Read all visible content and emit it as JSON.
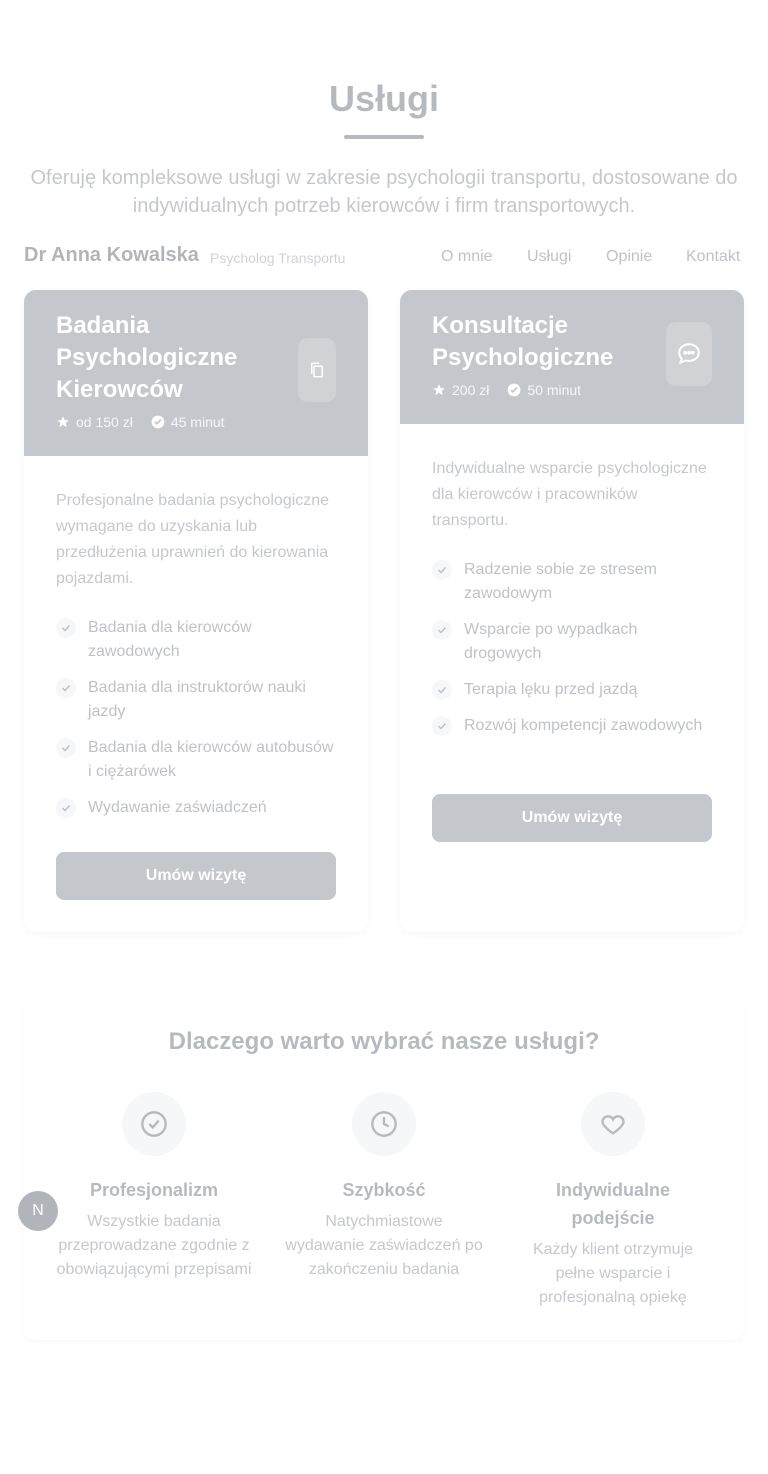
{
  "section": {
    "title": "Usługi",
    "lead": "Oferuję kompleksowe usługi w zakresie psychologii transportu, dostosowane do indywidualnych potrzeb kierowców i firm transportowych."
  },
  "header": {
    "brand": "Dr Anna Kowalska",
    "tagline": "Psycholog Transportu",
    "nav": [
      "O mnie",
      "Usługi",
      "Opinie",
      "Kontakt"
    ]
  },
  "services": [
    {
      "title": "Badania Psychologiczne Kierowców",
      "icon": "document-copy-icon",
      "price": "od 150 zł",
      "duration": "45 minut",
      "description": "Profesjonalne badania psychologiczne wymagane do uzyskania lub przedłużenia uprawnień do kierowania pojazdami.",
      "features": [
        "Badania dla kierowców zawodowych",
        "Badania dla instruktorów nauki jazdy",
        "Badania dla kierowców autobusów i ciężarówek",
        "Wydawanie zaświadczeń"
      ],
      "cta": "Umów wizytę"
    },
    {
      "title": "Konsultacje Psychologiczne",
      "icon": "chat-bubble-icon",
      "price": "200 zł",
      "duration": "50 minut",
      "description": "Indywidualne wsparcie psychologiczne dla kierowców i pracowników transportu.",
      "features": [
        "Radzenie sobie ze stresem zawodowym",
        "Wsparcie po wypadkach drogowych",
        "Terapia lęku przed jazdą",
        "Rozwój kompetencji zawodowych"
      ],
      "cta": "Umów wizytę"
    }
  ],
  "why": {
    "title": "Dlaczego warto wybrać nasze usługi?",
    "items": [
      {
        "icon": "check-circle-icon",
        "title": "Profesjonalizm",
        "text": "Wszystkie badania przeprowadzane zgodnie z obowiązującymi przepisami"
      },
      {
        "icon": "clock-icon",
        "title": "Szybkość",
        "text": "Natychmiastowe wydawanie zaświadczeń po zakończeniu badania"
      },
      {
        "icon": "heart-icon",
        "title": "Indywidualne podejście",
        "text": "Każdy klient otrzymuje pełne wsparcie i profesjonalną opiekę"
      }
    ]
  },
  "fab": {
    "label": "N"
  }
}
